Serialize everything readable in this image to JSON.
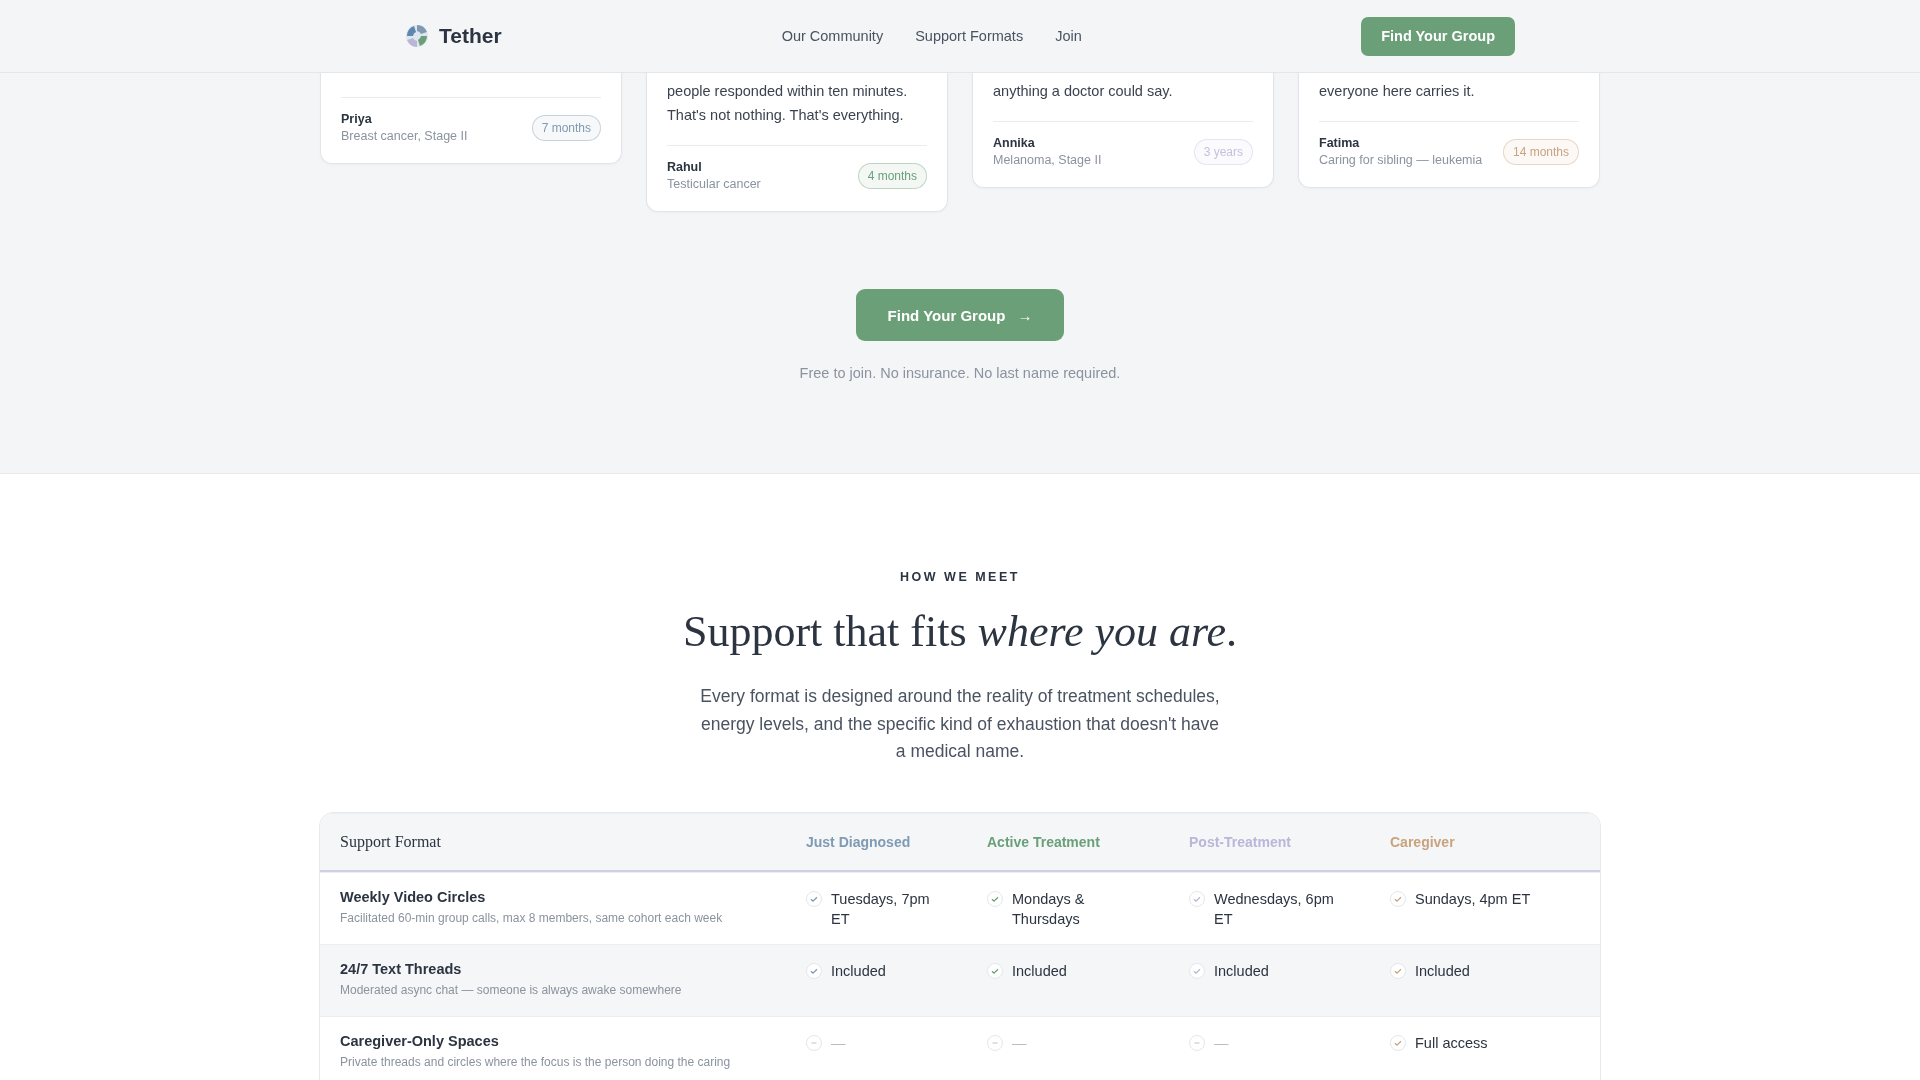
{
  "header": {
    "brand": "Tether",
    "nav": [
      "Our Community",
      "Support Formats",
      "Join"
    ],
    "cta": "Find Your Group"
  },
  "stories": [
    {
      "name": "Priya",
      "detail": "Breast cancer, Stage II",
      "duration": "7 months",
      "color": "#7f9ab3"
    },
    {
      "quote_lines": [
        "people responded within ten minutes.",
        "That's not nothing. That's everything."
      ],
      "name": "Rahul",
      "detail": "Testicular cancer",
      "duration": "4 months",
      "color": "#6a9f78"
    },
    {
      "quote_lines": [
        "anything a doctor could say."
      ],
      "name": "Annika",
      "detail": "Melanoma, Stage II",
      "duration": "3 years",
      "color": "#c4c1dd"
    },
    {
      "quote_lines": [
        "everyone here carries it."
      ],
      "name": "Fatima",
      "detail": "Caring for sibling — leukemia",
      "duration": "14 months",
      "color": "#c9a27e"
    }
  ],
  "cta": {
    "button": "Find Your Group",
    "arrow": "→",
    "note": "Free to join. No insurance. No last name required."
  },
  "formats": {
    "eyebrow": "HOW WE MEET",
    "heading": "Support that fits *where you are*.",
    "intro": "Every format is designed around the reality of treatment schedules, energy levels, and the specific kind of exhaustion that doesn't have a medical name.",
    "table": {
      "first_column": "Support Format",
      "columns": [
        {
          "label": "Just Diagnosed",
          "color": "#7f9ab3"
        },
        {
          "label": "Active Treatment",
          "color": "#6a9f78"
        },
        {
          "label": "Post-Treatment",
          "color": "#b9b6d8"
        },
        {
          "label": "Caregiver",
          "color": "#c9a27e"
        }
      ],
      "rows": [
        {
          "title": "Weekly Video Circles",
          "description": "Facilitated 60-min group calls, max 8 members, same cohort each week",
          "shaded": false,
          "cells": [
            {
              "kind": "check",
              "text": "Tuesdays, 7pm ET"
            },
            {
              "kind": "check",
              "text": "Mondays & Thursdays"
            },
            {
              "kind": "check",
              "text": "Wednesdays, 6pm ET"
            },
            {
              "kind": "check",
              "text": "Sundays, 4pm ET"
            }
          ]
        },
        {
          "title": "24/7 Text Threads",
          "description": "Moderated async chat — someone is always awake somewhere",
          "shaded": true,
          "cells": [
            {
              "kind": "check",
              "text": "Included"
            },
            {
              "kind": "check",
              "text": "Included"
            },
            {
              "kind": "check",
              "text": "Included"
            },
            {
              "kind": "check",
              "text": "Included"
            }
          ]
        },
        {
          "title": "Caregiver-Only Spaces",
          "description": "Private threads and circles where the focus is the person doing the caring",
          "shaded": false,
          "cells": [
            {
              "kind": "none",
              "text": "—"
            },
            {
              "kind": "none",
              "text": "—"
            },
            {
              "kind": "none",
              "text": "—"
            },
            {
              "kind": "check",
              "text": "Full access"
            }
          ]
        }
      ]
    }
  }
}
